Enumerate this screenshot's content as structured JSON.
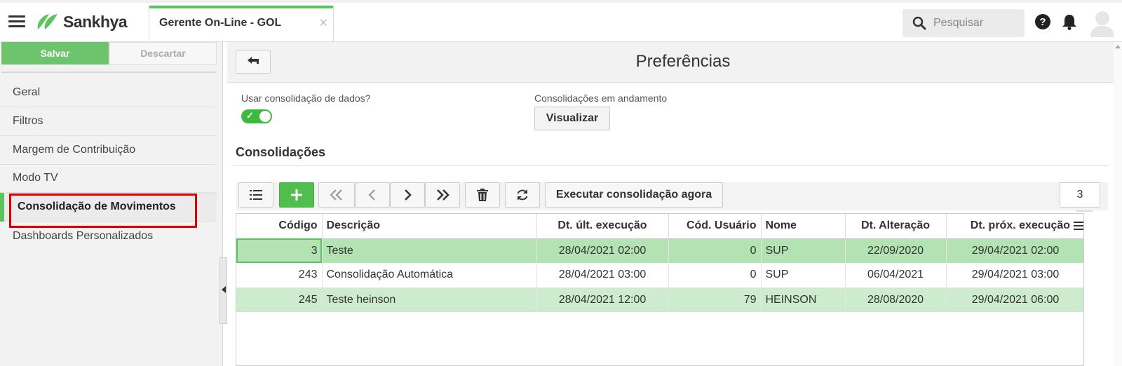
{
  "header": {
    "app_name": "Sankhya",
    "tab_label": "Gerente On-Line - GOL",
    "tab_close": "×",
    "search_placeholder": "Pesquisar"
  },
  "sidebar": {
    "save_label": "Salvar",
    "discard_label": "Descartar",
    "items": [
      {
        "label": "Geral"
      },
      {
        "label": "Filtros"
      },
      {
        "label": "Margem de Contribuição"
      },
      {
        "label": "Modo TV"
      },
      {
        "label": "Consolidação de Movimentos",
        "active": true
      },
      {
        "label": "Dashboards Personalizados"
      }
    ]
  },
  "main": {
    "title": "Preferências",
    "use_consolidation_label": "Usar consolidação de dados?",
    "use_consolidation_value": true,
    "in_progress_label": "Consolidações em andamento",
    "view_button": "Visualizar",
    "section_title": "Consolidações",
    "toolbar": {
      "execute_label": "Executar consolidação agora",
      "record_count": "3"
    },
    "grid": {
      "columns": [
        "Código",
        "Descrição",
        "Dt. últ. execução",
        "Cód. Usuário",
        "Nome",
        "Dt. Alteração",
        "Dt. próx. execução"
      ],
      "rows": [
        [
          "3",
          "Teste",
          "28/04/2021 02:00",
          "0",
          "SUP",
          "22/09/2020",
          "29/04/2021 02:00"
        ],
        [
          "243",
          "Consolidação Automática",
          "28/04/2021 03:00",
          "0",
          "SUP",
          "06/04/2021",
          "29/04/2021 03:00"
        ],
        [
          "245",
          "Teste heinson",
          "28/04/2021 12:00",
          "79",
          "HEINSON",
          "28/08/2020",
          "29/04/2021 06:00"
        ]
      ]
    }
  },
  "colors": {
    "accent_green": "#5cc45c",
    "selected_row": "#b3e3b3",
    "highlight_row": "#cdeccd",
    "annotation_red": "#e00000"
  }
}
